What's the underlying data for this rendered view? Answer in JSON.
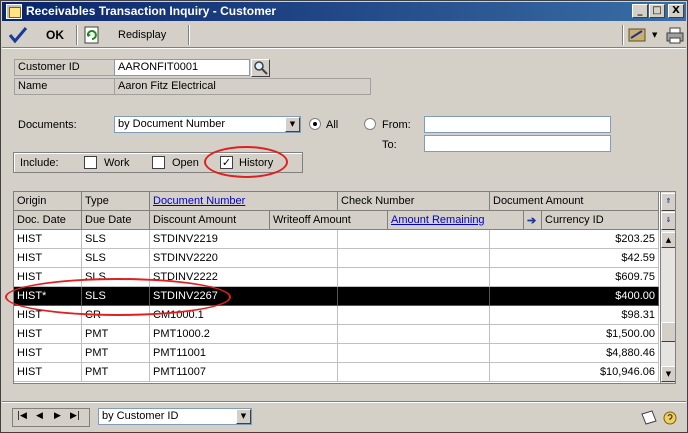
{
  "window": {
    "title": "Receivables Transaction Inquiry - Customer",
    "min_symbol": "_",
    "max_symbol": "□",
    "close_symbol": "X"
  },
  "toolbar": {
    "ok_label": "OK",
    "redisplay_label": "Redisplay"
  },
  "form": {
    "customer_id_label": "Customer ID",
    "customer_id_value": "AARONFIT0001",
    "name_label": "Name",
    "name_value": "Aaron Fitz Electrical",
    "documents_label": "Documents:",
    "documents_value": "by Document Number",
    "all_label": "All",
    "from_label": "From:",
    "to_label": "To:",
    "include_label": "Include:",
    "work_label": "Work",
    "open_label": "Open",
    "history_label": "History",
    "history_checked_mark": "✓"
  },
  "grid": {
    "headers_row1": [
      "Origin",
      "Type",
      "Document Number",
      "Check Number",
      "Document Amount"
    ],
    "headers_row2": [
      "Doc. Date",
      "Due Date",
      "Discount Amount",
      "Writeoff Amount",
      "Amount Remaining",
      "Currency ID"
    ],
    "rows": [
      {
        "origin": "HIST",
        "type": "SLS",
        "doc": "STDINV2219",
        "amount": "$203.25"
      },
      {
        "origin": "HIST",
        "type": "SLS",
        "doc": "STDINV2220",
        "amount": "$42.59"
      },
      {
        "origin": "HIST",
        "type": "SLS",
        "doc": "STDINV2222",
        "amount": "$609.75"
      },
      {
        "origin": "HIST*",
        "type": "SLS",
        "doc": "STDINV2267",
        "amount": "$400.00"
      },
      {
        "origin": "HIST",
        "type": "CR",
        "doc": "CM1000.1",
        "amount": "$98.31"
      },
      {
        "origin": "HIST",
        "type": "PMT",
        "doc": "PMT1000.2",
        "amount": "$1,500.00"
      },
      {
        "origin": "HIST",
        "type": "PMT",
        "doc": "PMT11001",
        "amount": "$4,880.46"
      },
      {
        "origin": "HIST",
        "type": "PMT",
        "doc": "PMT11007",
        "amount": "$10,946.06"
      }
    ]
  },
  "footer": {
    "sort_value": "by Customer ID"
  },
  "colors": {
    "title_bar": "#0a246a",
    "selected_row": "#000000",
    "highlight_circle": "#e02020",
    "link": "#0000cc"
  }
}
